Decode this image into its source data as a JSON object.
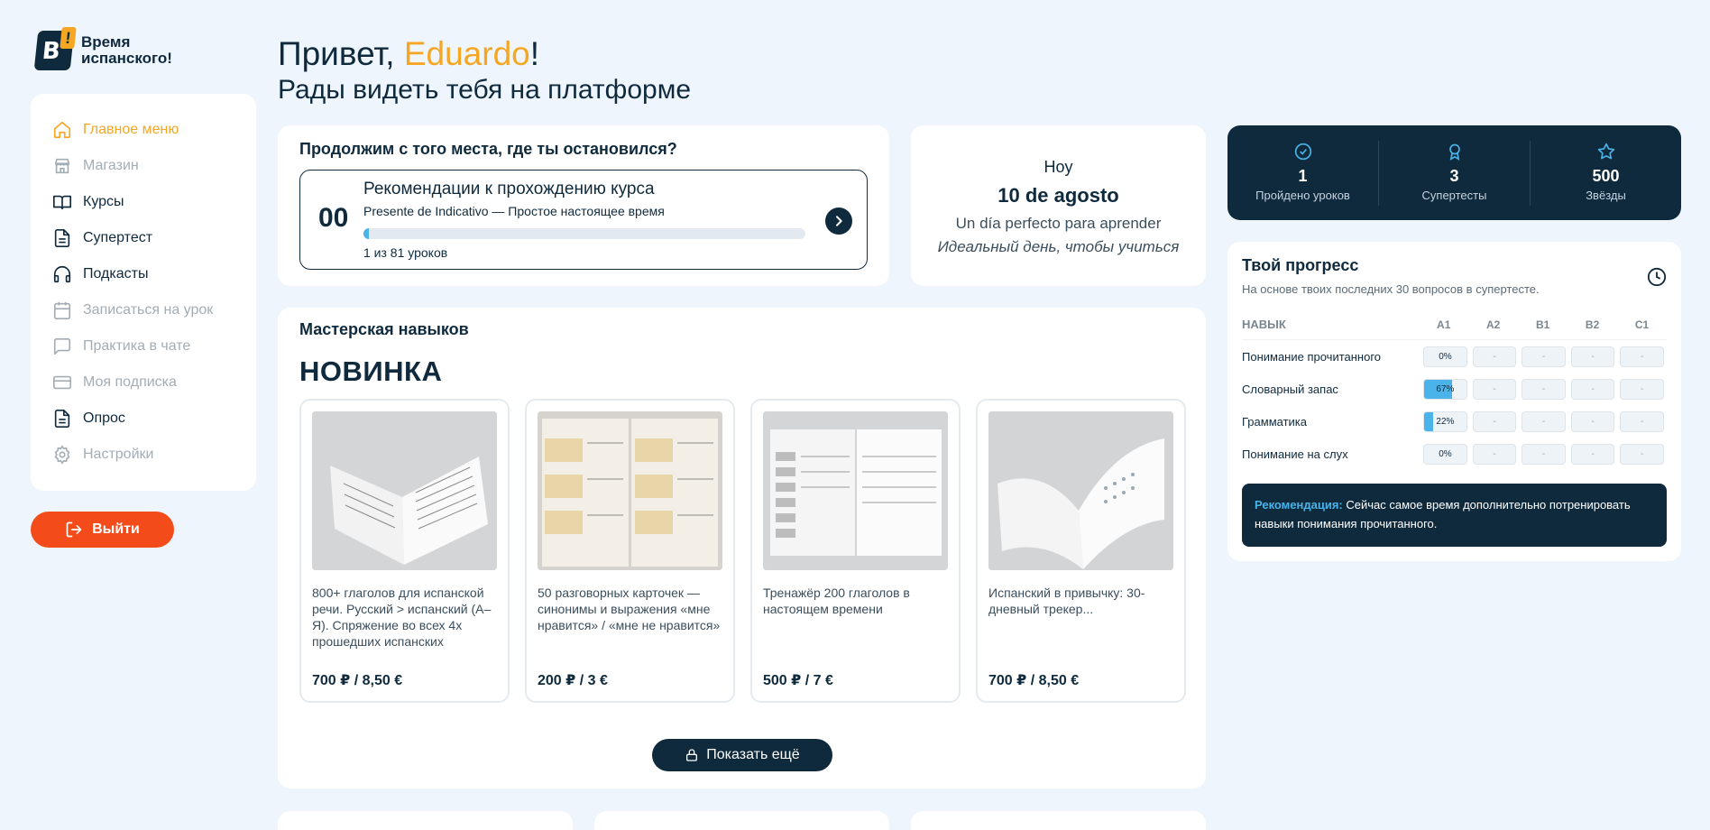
{
  "logo": {
    "line1": "Время",
    "line2": "испанского!"
  },
  "sidebar": {
    "items": [
      {
        "label": "Главное меню",
        "icon": "home-icon",
        "state": "active"
      },
      {
        "label": "Магазин",
        "icon": "store-icon",
        "state": "dim"
      },
      {
        "label": "Курсы",
        "icon": "book-icon",
        "state": "normal"
      },
      {
        "label": "Супертест",
        "icon": "document-icon",
        "state": "normal"
      },
      {
        "label": "Подкасты",
        "icon": "headphones-icon",
        "state": "normal"
      },
      {
        "label": "Записаться на урок",
        "icon": "calendar-icon",
        "state": "dim"
      },
      {
        "label": "Практика в чате",
        "icon": "chat-icon",
        "state": "dim"
      },
      {
        "label": "Моя подписка",
        "icon": "card-icon",
        "state": "dim"
      },
      {
        "label": "Опрос",
        "icon": "document-icon",
        "state": "normal"
      },
      {
        "label": "Настройки",
        "icon": "gear-icon",
        "state": "dim"
      }
    ],
    "logout_label": "Выйти"
  },
  "greeting": {
    "hello": "Привет, ",
    "name": "Eduardo",
    "excl": "!",
    "subtitle": "Рады видеть тебя на платформе"
  },
  "continue": {
    "title": "Продолжим с того места, где ты остановился?",
    "number": "00",
    "course_title": "Рекомендации к прохождению курса",
    "course_sub": "Presente de Indicativo — Простое настоящее время",
    "progress": 0.0123,
    "count": "1 из 81 уроков"
  },
  "today": {
    "label": "Hoy",
    "date": "10 de agosto",
    "es": "Un día perfecto para aprender",
    "ru": "Идеальный день, чтобы учиться"
  },
  "workshop": {
    "title": "Мастерская навыков",
    "badge": "НОВИНКА",
    "products": [
      {
        "title": "800+ глаголов для испанской речи. Русский > испанский (А–Я). Спряжение во всех 4х прошедших испанских",
        "price": "700 ₽ / 8,50 €"
      },
      {
        "title": "50 разговорных карточек — синонимы и выражения «мне нравится» / «мне не нравится»",
        "price": "200 ₽ / 3 €"
      },
      {
        "title": "Тренажёр 200 глаголов в настоящем времени",
        "price": "500 ₽ / 7 €"
      },
      {
        "title": "Испанский в привычку: 30-дневный трекер...",
        "price": "700 ₽ / 8,50 €"
      }
    ],
    "show_more": "Показать ещё"
  },
  "stats": [
    {
      "value": "1",
      "label": "Пройдено уроков",
      "icon": "check-circle-icon"
    },
    {
      "value": "3",
      "label": "Супертесты",
      "icon": "award-icon"
    },
    {
      "value": "500",
      "label": "Звёзды",
      "icon": "star-icon"
    }
  ],
  "progress": {
    "title": "Твой прогресс",
    "subtitle": "На основе твоих последних 30 вопросов в супертесте.",
    "headers": {
      "skill": "НАВЫК",
      "a1": "A1",
      "a2": "A2",
      "b1": "B1",
      "b2": "B2",
      "c1": "C1"
    },
    "empty": "-",
    "rows": [
      {
        "skill": "Понимание прочитанного",
        "a1": "0%",
        "a1_value": 0
      },
      {
        "skill": "Словарный запас",
        "a1": "67%",
        "a1_value": 0.67
      },
      {
        "skill": "Грамматика",
        "a1": "22%",
        "a1_value": 0.22
      },
      {
        "skill": "Понимание на слух",
        "a1": "0%",
        "a1_value": 0
      }
    ],
    "recommendation_key": "Рекомендация:",
    "recommendation_text": " Сейчас самое время дополнительно потренировать навыки понимания прочитанного."
  },
  "colors": {
    "accent": "#f5a623",
    "navy": "#0f2a3d",
    "logout": "#f34b1a",
    "progress": "#4ab3ea"
  }
}
